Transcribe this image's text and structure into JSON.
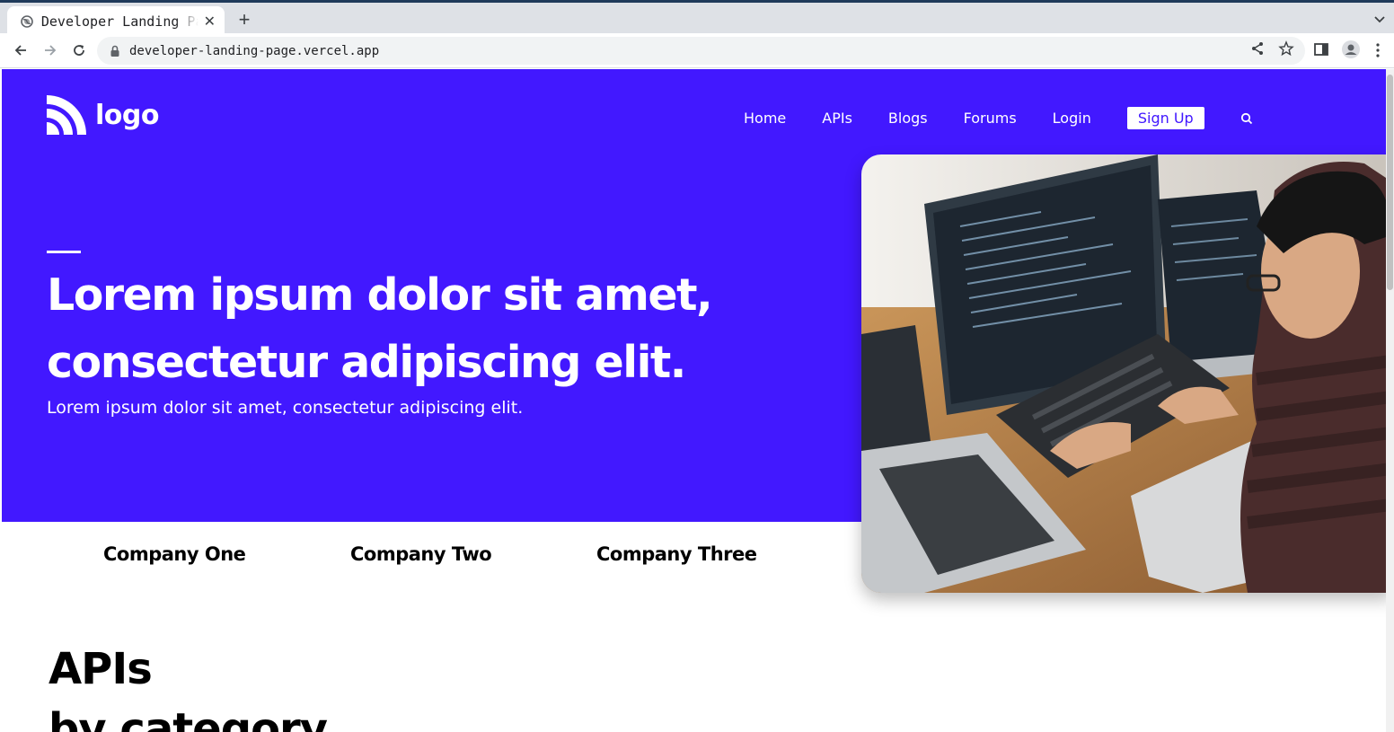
{
  "browser": {
    "tab_title": "Developer Landing Page",
    "close_glyph": "✕",
    "newtab_glyph": "+",
    "url": "developer-landing-page.vercel.app"
  },
  "page": {
    "logo_text": "logo",
    "nav": {
      "home": "Home",
      "apis": "APIs",
      "blogs": "Blogs",
      "forums": "Forums",
      "login": "Login",
      "signup": "Sign Up"
    },
    "headline_line1": "Lorem ipsum dolor sit amet,",
    "headline_line2": "consectetur adipiscing elit.",
    "subline": "Lorem ipsum dolor sit amet, consectetur adipiscing elit.",
    "companies": [
      "Company One",
      "Company Two",
      "Company Three"
    ],
    "apis_title": "APIs",
    "apis_sub": "by category"
  },
  "colors": {
    "brand": "#4218ff",
    "white": "#ffffff"
  }
}
